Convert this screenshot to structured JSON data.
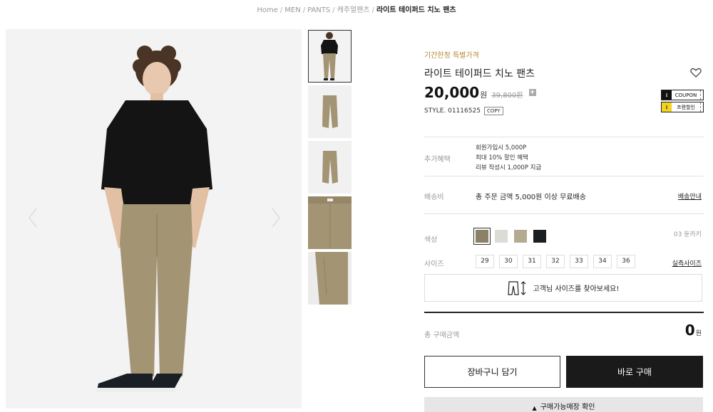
{
  "breadcrumb": {
    "items": [
      "Home",
      "MEN",
      "PANTS",
      "캐주얼팬츠"
    ],
    "current": "라이트 테이퍼드 치노 팬츠",
    "separator": "/"
  },
  "product": {
    "promo": "기간한정 특별가격",
    "title": "라이트 테이퍼드 치노 팬츠",
    "price": "20,000",
    "price_unit": "원",
    "original_price": "39,800원",
    "style_label": "STYLE. 01116525",
    "copy_label": "COPY"
  },
  "coupons": [
    {
      "label": "COUPON",
      "icon": "download-icon",
      "color": "#111111"
    },
    {
      "label": "프렌할인",
      "icon": "download-icon",
      "color": "#f4d422"
    }
  ],
  "benefits": {
    "label": "추가혜택",
    "lines": [
      "회원가입시 5,000P",
      "최대 10% 할인 혜택",
      "리뷰 작성시 1,000P 지급"
    ]
  },
  "shipping": {
    "label": "배송비",
    "text": "총 주문 금액 5,000원 이상 무료배송",
    "link": "배송안내"
  },
  "color": {
    "label": "색상",
    "selected_name": "03 듄카키",
    "swatches": [
      "#8b8068",
      "#dcdcd6",
      "#b2ab92",
      "#1b1e22"
    ]
  },
  "size": {
    "label": "사이즈",
    "options": [
      "29",
      "30",
      "31",
      "32",
      "33",
      "34",
      "36"
    ],
    "link": "실측사이즈"
  },
  "size_finder": "고객님 사이즈를 찾아보세요!",
  "total": {
    "label": "총 구매금액",
    "value": "0",
    "unit": "원"
  },
  "buttons": {
    "cart": "장바구니 담기",
    "buy": "바로 구매",
    "store": "구매가능매장 확인"
  },
  "colors": {
    "promo": "#b8862f",
    "buy_bg": "#1a1a1a",
    "pants": "#a39474",
    "shirt": "#141414",
    "photo_bg": "#f3f3f3"
  }
}
